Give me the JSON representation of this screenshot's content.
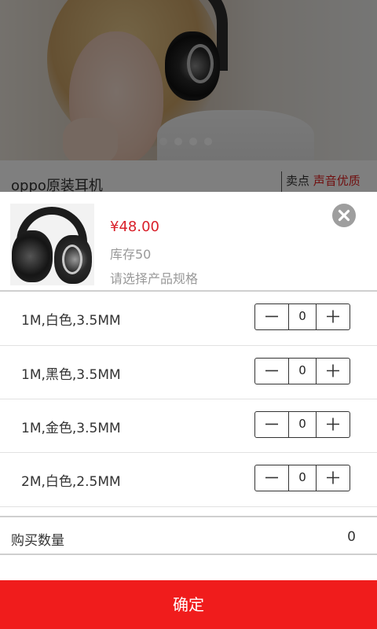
{
  "background": {
    "banner": {
      "image": "woman-wearing-headphones",
      "slide_dots": 4,
      "active_dot": 1
    },
    "product_title": "oppo原装耳机",
    "selling_point_label": "卖点",
    "selling_point_value": "声音优质"
  },
  "sheet": {
    "thumbnail": "headphones-product-image",
    "price": "¥48.00",
    "stock": "库存50",
    "spec_hint": "请选择产品规格",
    "close_icon": "close-icon",
    "specs": [
      {
        "label": "1M,白色,3.5MM",
        "qty": "0"
      },
      {
        "label": "1M,黑色,3.5MM",
        "qty": "0"
      },
      {
        "label": "1M,金色,3.5MM",
        "qty": "0"
      },
      {
        "label": "2M,白色,2.5MM",
        "qty": "0"
      }
    ],
    "quantity_label": "购买数量",
    "quantity_value": "0",
    "confirm_label": "确定"
  },
  "colors": {
    "accent_red": "#f01c1c",
    "price_red": "#d9202a",
    "muted_text": "#999999",
    "close_grey": "#9e9e9e"
  }
}
